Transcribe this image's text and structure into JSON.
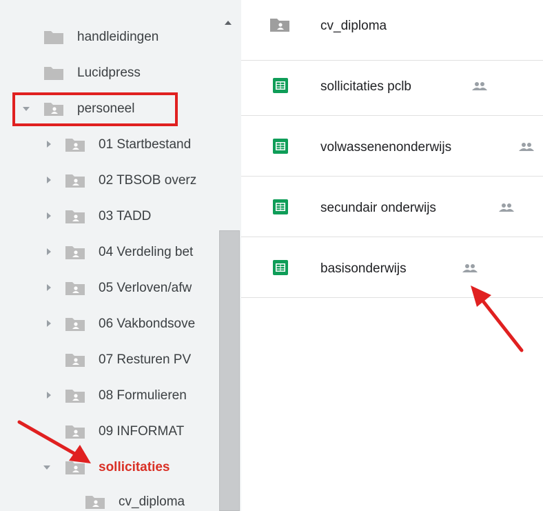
{
  "sidebar": {
    "items": [
      {
        "label": "handleidingen",
        "type": "folder",
        "caret": "none"
      },
      {
        "label": "Lucidpress",
        "type": "folder",
        "caret": "none"
      },
      {
        "label": "personeel",
        "type": "shared-folder",
        "caret": "down"
      },
      {
        "label": "01 Startbestand",
        "type": "shared-folder",
        "caret": "right"
      },
      {
        "label": "02 TBSOB overz",
        "type": "shared-folder",
        "caret": "right"
      },
      {
        "label": "03 TADD",
        "type": "shared-folder",
        "caret": "right"
      },
      {
        "label": "04 Verdeling bet",
        "type": "shared-folder",
        "caret": "right"
      },
      {
        "label": "05 Verloven/afw",
        "type": "shared-folder",
        "caret": "right"
      },
      {
        "label": "06 Vakbondsove",
        "type": "shared-folder",
        "caret": "right"
      },
      {
        "label": "07 Resturen PV",
        "type": "shared-folder",
        "caret": "none"
      },
      {
        "label": "08 Formulieren",
        "type": "shared-folder",
        "caret": "right"
      },
      {
        "label": "09 INFORMAT",
        "type": "shared-folder",
        "caret": "none"
      },
      {
        "label": "sollicitaties",
        "type": "shared-folder",
        "caret": "down",
        "active": true
      },
      {
        "label": "cv_diploma",
        "type": "shared-folder",
        "caret": "none"
      }
    ]
  },
  "files": [
    {
      "name": "cv_diploma",
      "icon": "shared-folder-icon",
      "shared": false
    },
    {
      "name": "sollicitaties pclb",
      "icon": "sheets-icon",
      "shared": true
    },
    {
      "name": "volwassenenonderwijs",
      "icon": "sheets-icon",
      "shared": true
    },
    {
      "name": "secundair onderwijs",
      "icon": "sheets-icon",
      "shared": true
    },
    {
      "name": "basisonderwijs",
      "icon": "sheets-icon",
      "shared": true
    }
  ],
  "colors": {
    "folder": "#bdbdbd",
    "sheets": "#0f9d58",
    "active_text": "#d93025",
    "annotation": "#e02020"
  }
}
